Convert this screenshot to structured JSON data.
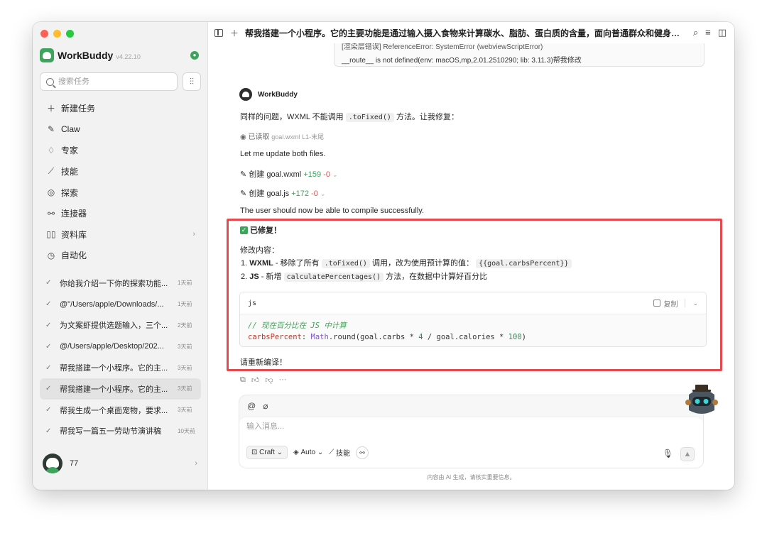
{
  "app": {
    "name": "WorkBuddy",
    "version": "v4.22.10"
  },
  "sidebar": {
    "search_placeholder": "搜索任务",
    "nav": [
      {
        "label": "新建任务",
        "icon": "plus-icon"
      },
      {
        "label": "Claw",
        "icon": "claw-icon"
      },
      {
        "label": "专家",
        "icon": "graduation-cap-icon"
      },
      {
        "label": "技能",
        "icon": "magic-wand-icon"
      },
      {
        "label": "探索",
        "icon": "compass-icon"
      },
      {
        "label": "连接器",
        "icon": "connector-icon"
      },
      {
        "label": "资料库",
        "icon": "book-icon"
      },
      {
        "label": "自动化",
        "icon": "clock-icon"
      }
    ],
    "tasks": [
      {
        "title": "你给我介绍一下你的探索功能...",
        "time": "1天前"
      },
      {
        "title": "@\"/Users/apple/Downloads/...",
        "time": "1天前"
      },
      {
        "title": "为文案虾提供选题输入，三个...",
        "time": "2天前"
      },
      {
        "title": "@/Users/apple/Desktop/202...",
        "time": "3天前"
      },
      {
        "title": "帮我搭建一个小程序。它的主...",
        "time": "3天前"
      },
      {
        "title": "帮我搭建一个小程序。它的主...",
        "time": "3天前",
        "active": true
      },
      {
        "title": "帮我生成一个桌面宠物，要求...",
        "time": "3天前"
      },
      {
        "title": "帮我写一篇五一劳动节演讲稿",
        "time": "10天前"
      }
    ],
    "user": {
      "name": "77"
    }
  },
  "topbar": {
    "title": "帮我搭建一个小程序。它的主要功能是通过输入摄入食物来计算碳水、脂肪、蛋白质的含量，面向普通群众和健身爱好..."
  },
  "quote": {
    "line1": "[渲染层错误] ReferenceError: SystemError (webviewScriptError)",
    "line2": "__route__ is not defined(env: macOS,mp,2.01.2510290; lib: 3.11.3)帮我修改"
  },
  "message": {
    "author": "WorkBuddy",
    "intro_prefix": "同样的问题，WXML 不能调用",
    "intro_code": ".toFixed()",
    "intro_suffix": "方法。让我修复：",
    "read_label": "已读取",
    "read_file": "goal.wxml",
    "read_range": "L1-末尾",
    "update_text": "Let me update both files.",
    "create_label": "创建",
    "file1": {
      "name": "goal.wxml",
      "add": "+159",
      "del": "-0"
    },
    "file2": {
      "name": "goal.js",
      "add": "+172",
      "del": "-0"
    },
    "compile_text": "The user should now be able to compile successfully.",
    "fixed_label": "已修复！",
    "changes_label": "修改内容：",
    "item1": {
      "num": "1.",
      "key": "WXML",
      "text1": "- 移除了所有",
      "code1": ".toFixed()",
      "text2": "调用，改为使用预计算的值：",
      "code2": "{{goal.carbsPercent}}"
    },
    "item2": {
      "num": "2.",
      "key": "JS",
      "text1": "- 新增",
      "code1": "calculatePercentages()",
      "text2": "方法，在数据中计算好百分比"
    },
    "code": {
      "lang": "js",
      "copy_label": "复制",
      "comment": "// 现在百分比在 JS 中计算",
      "prop": "carbsPercent",
      "colon": ": ",
      "obj": "Math",
      "call": ".round(goal.carbs * ",
      "num1": "4",
      "mid": " / goal.calories * ",
      "num2": "100",
      "end": ")"
    },
    "recompile": "请重新编译！"
  },
  "composer": {
    "placeholder": "输入消息...",
    "mode": "Craft",
    "model": "Auto",
    "skills": "技能"
  },
  "footnote": "内容由 AI 生成，请核实重要信息。",
  "colors": {
    "accent": "#3da35d",
    "highlight": "#e5484d"
  }
}
